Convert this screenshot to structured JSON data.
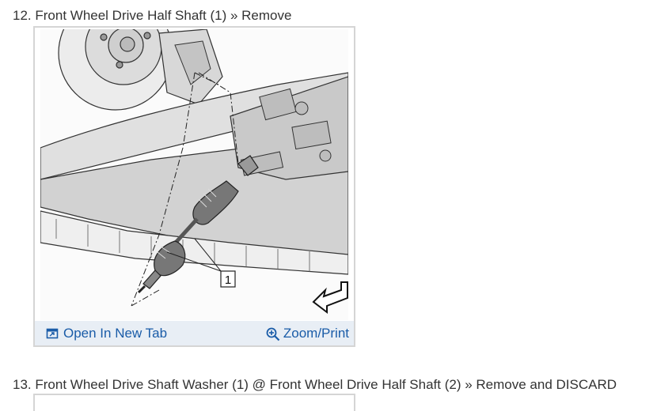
{
  "step12": {
    "number": "12.",
    "title": "Front Wheel Drive Half Shaft (1) » Remove",
    "figure": {
      "callout": "1",
      "open_in_new_tab_label": "Open In New Tab",
      "zoom_print_label": "Zoom/Print",
      "link_color": "#1a5ca8",
      "bar_color": "#e8eef5"
    }
  },
  "step13": {
    "number": "13.",
    "title": "Front Wheel Drive Shaft Washer (1) @ Front Wheel Drive Half Shaft (2) » Remove and DISCARD"
  }
}
